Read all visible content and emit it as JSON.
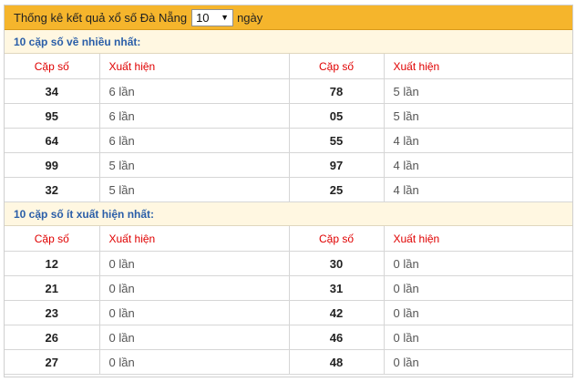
{
  "header": {
    "title_prefix": "Thống kê kết quả xổ số Đà Nẵng",
    "select_value": "10",
    "title_suffix": "ngày"
  },
  "most": {
    "heading": "10 cặp số về nhiều nhất:",
    "col_pair": "Cặp số",
    "col_count": "Xuất hiện",
    "rows": [
      {
        "a_pair": "34",
        "a_count": "6 lần",
        "b_pair": "78",
        "b_count": "5 lần"
      },
      {
        "a_pair": "95",
        "a_count": "6 lần",
        "b_pair": "05",
        "b_count": "5 lần"
      },
      {
        "a_pair": "64",
        "a_count": "6 lần",
        "b_pair": "55",
        "b_count": "4 lần"
      },
      {
        "a_pair": "99",
        "a_count": "5 lần",
        "b_pair": "97",
        "b_count": "4 lần"
      },
      {
        "a_pair": "32",
        "a_count": "5 lần",
        "b_pair": "25",
        "b_count": "4 lần"
      }
    ]
  },
  "least": {
    "heading": "10 cặp số ít xuất hiện nhất:",
    "col_pair": "Cặp số",
    "col_count": "Xuất hiện",
    "rows": [
      {
        "a_pair": "12",
        "a_count": "0 lần",
        "b_pair": "30",
        "b_count": "0 lần"
      },
      {
        "a_pair": "21",
        "a_count": "0 lần",
        "b_pair": "31",
        "b_count": "0 lần"
      },
      {
        "a_pair": "23",
        "a_count": "0 lần",
        "b_pair": "42",
        "b_count": "0 lần"
      },
      {
        "a_pair": "26",
        "a_count": "0 lần",
        "b_pair": "46",
        "b_count": "0 lần"
      },
      {
        "a_pair": "27",
        "a_count": "0 lần",
        "b_pair": "48",
        "b_count": "0 lần"
      }
    ]
  }
}
